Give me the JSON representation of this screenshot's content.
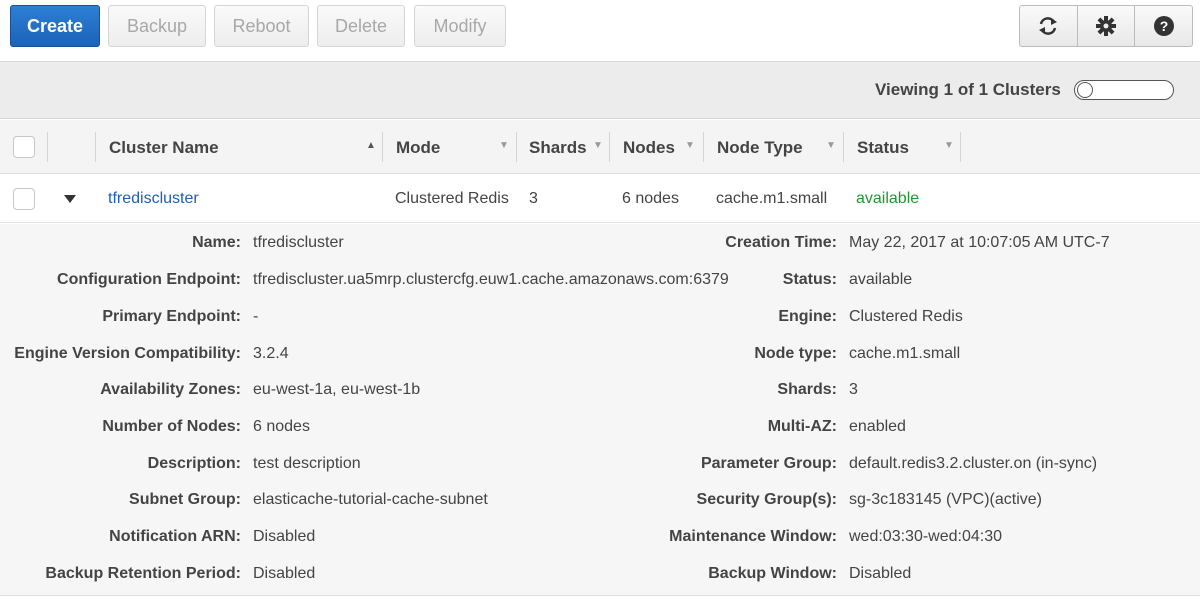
{
  "toolbar": {
    "create": "Create",
    "backup": "Backup",
    "reboot": "Reboot",
    "delete": "Delete",
    "modify": "Modify",
    "icons": [
      "refresh-icon",
      "gear-icon",
      "help-icon"
    ]
  },
  "viewing": {
    "text": "Viewing 1 of 1 Clusters"
  },
  "table": {
    "columns": [
      "Cluster Name",
      "Mode",
      "Shards",
      "Nodes",
      "Node Type",
      "Status"
    ],
    "row": {
      "name": "tfrediscluster",
      "mode": "Clustered Redis",
      "shards": "3",
      "nodes": "6 nodes",
      "node_type": "cache.m1.small",
      "status": "available"
    }
  },
  "details": {
    "left": [
      {
        "label": "Name:",
        "value": "tfrediscluster"
      },
      {
        "label": "Configuration Endpoint:",
        "value": "tfrediscluster.ua5mrp.clustercfg.euw1.cache.amazonaws.com:6379"
      },
      {
        "label": "Primary Endpoint:",
        "value": "-"
      },
      {
        "label": "Engine Version Compatibility:",
        "value": "3.2.4"
      },
      {
        "label": "Availability Zones:",
        "value": "eu-west-1a, eu-west-1b"
      },
      {
        "label": "Number of Nodes:",
        "value": "6 nodes"
      },
      {
        "label": "Description:",
        "value": "test description"
      },
      {
        "label": "Subnet Group:",
        "value": "elasticache-tutorial-cache-subnet"
      },
      {
        "label": "Notification ARN:",
        "value": "Disabled"
      },
      {
        "label": "Backup Retention Period:",
        "value": "Disabled"
      }
    ],
    "right": [
      {
        "label": "Creation Time:",
        "value": "May 22, 2017 at 10:07:05 AM UTC-7"
      },
      {
        "label": "Status:",
        "value": "available"
      },
      {
        "label": "Engine:",
        "value": "Clustered Redis"
      },
      {
        "label": "Node type:",
        "value": "cache.m1.small"
      },
      {
        "label": "Shards:",
        "value": "3"
      },
      {
        "label": "Multi-AZ:",
        "value": "enabled"
      },
      {
        "label": "Parameter Group:",
        "value": "default.redis3.2.cluster.on (in-sync)"
      },
      {
        "label": "Security Group(s):",
        "value": "sg-3c183145 (VPC)(active)"
      },
      {
        "label": "Maintenance Window:",
        "value": "wed:03:30-wed:04:30"
      },
      {
        "label": "Backup Window:",
        "value": "Disabled"
      }
    ]
  },
  "colors": {
    "primary": "#1f6fc8",
    "link": "#1f5fb5",
    "status_ok": "#1e9a2e"
  }
}
